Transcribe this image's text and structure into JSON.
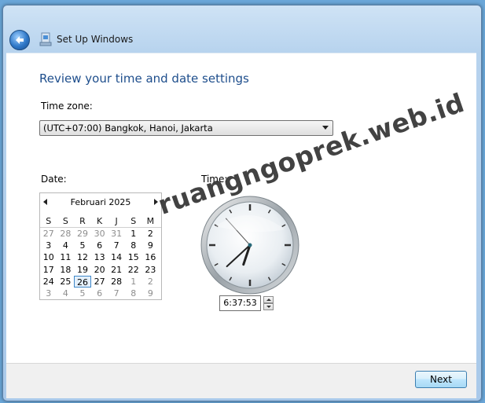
{
  "window": {
    "title": "Set Up Windows"
  },
  "page": {
    "heading": "Review your time and date settings"
  },
  "timezone": {
    "label": "Time zone:",
    "value": "(UTC+07:00) Bangkok, Hanoi, Jakarta"
  },
  "date": {
    "label": "Date:",
    "calendar": {
      "month": "Februari 2025",
      "days_of_week": [
        "S",
        "S",
        "R",
        "K",
        "J",
        "S",
        "M"
      ],
      "weeks": [
        [
          "27",
          "28",
          "29",
          "30",
          "31",
          "1",
          "2"
        ],
        [
          "3",
          "4",
          "5",
          "6",
          "7",
          "8",
          "9"
        ],
        [
          "10",
          "11",
          "12",
          "13",
          "14",
          "15",
          "16"
        ],
        [
          "17",
          "18",
          "19",
          "20",
          "21",
          "22",
          "23"
        ],
        [
          "24",
          "25",
          "26",
          "27",
          "28",
          "1",
          "2"
        ],
        [
          "3",
          "4",
          "5",
          "6",
          "7",
          "8",
          "9"
        ]
      ],
      "selected": "26"
    }
  },
  "time": {
    "label": "Time:",
    "value": "6:37:53"
  },
  "watermark": "ruangngoprek.web.id",
  "footer": {
    "next_label": "Next"
  },
  "colors": {
    "heading": "#1e4e8c",
    "accent": "#3f87c8"
  },
  "icons": {
    "back": "back-arrow-icon",
    "app": "windows-setup-icon",
    "dropdown": "chevron-down-icon"
  }
}
